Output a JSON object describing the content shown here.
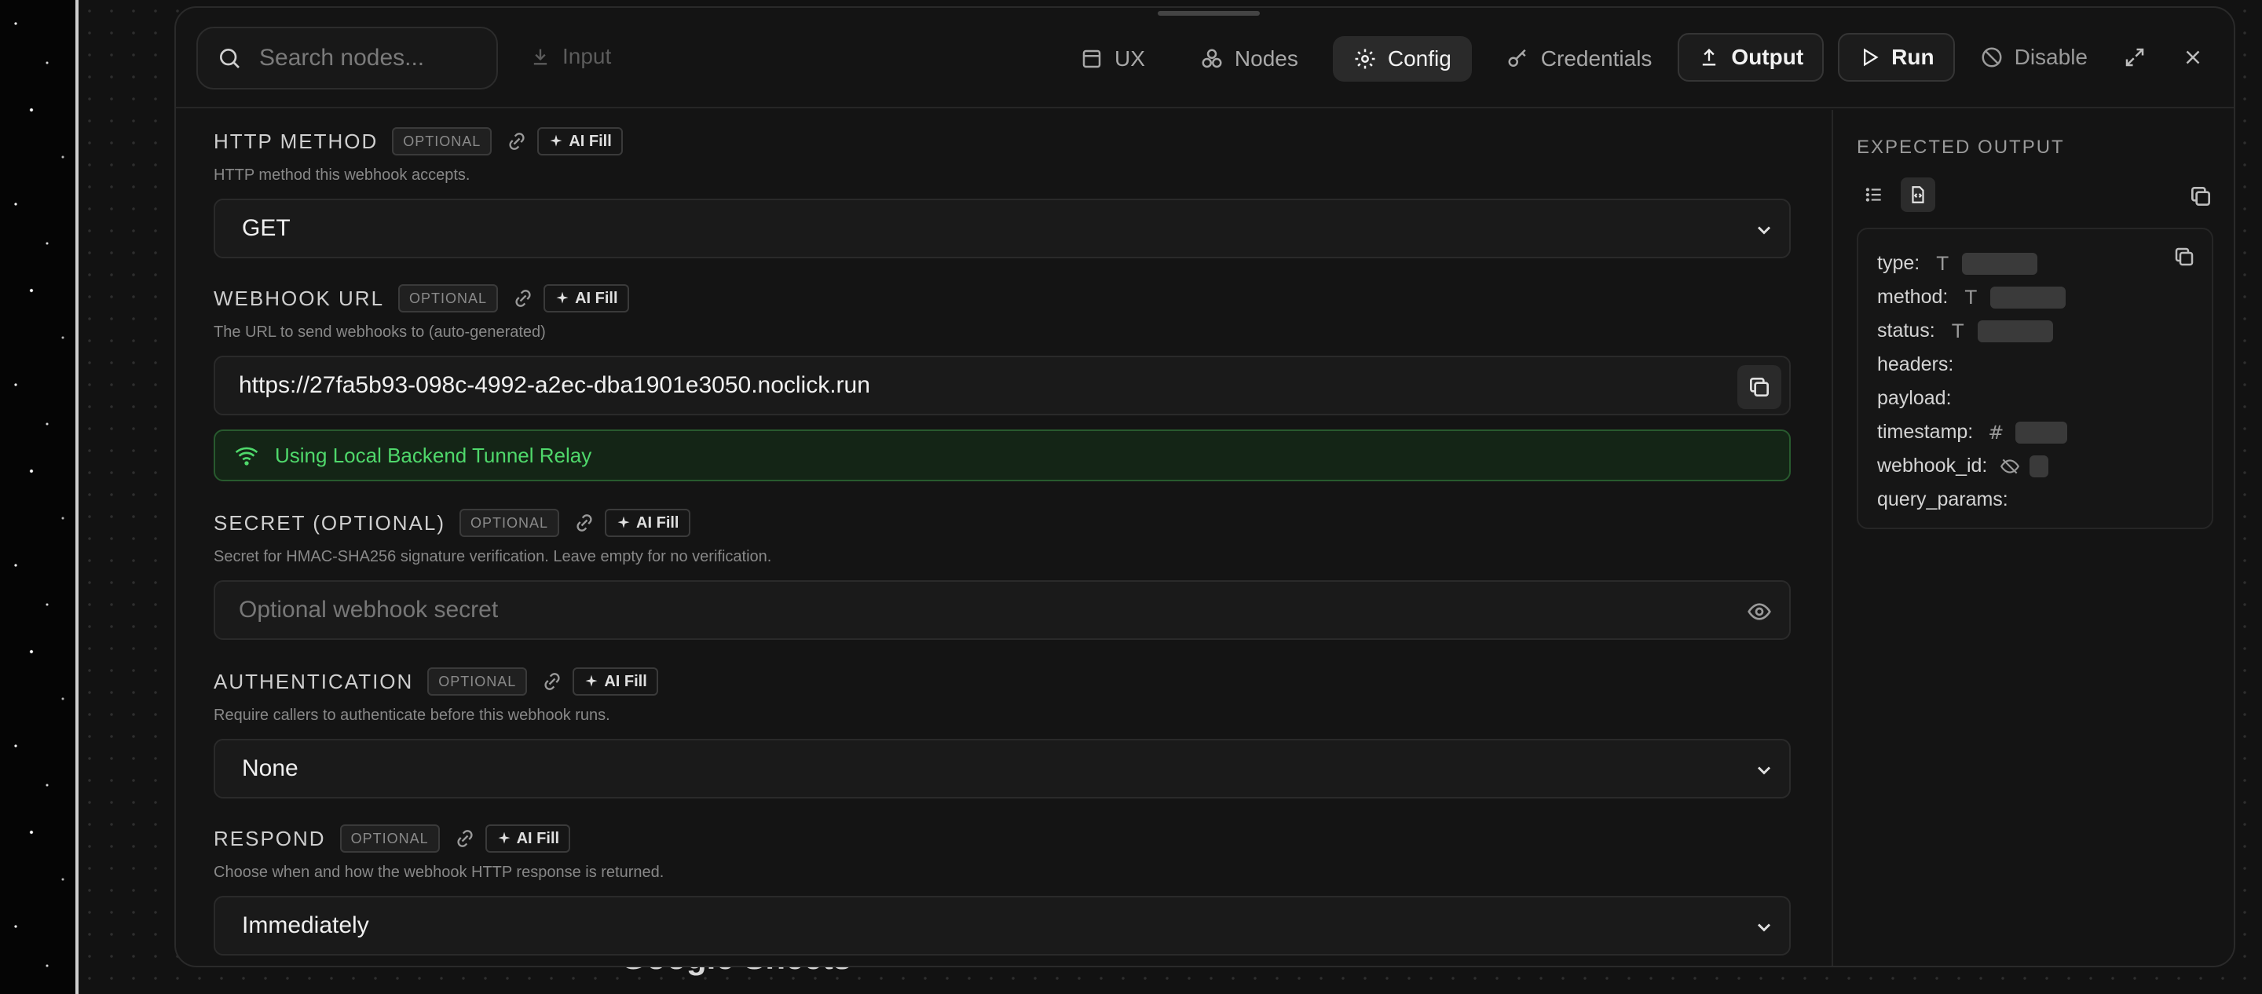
{
  "background": {
    "node_title": "Google Sheets"
  },
  "toolbar": {
    "search_placeholder": "Search nodes...",
    "input_label": "Input",
    "tabs": [
      {
        "label": "UX",
        "icon": "panel-icon",
        "active": false
      },
      {
        "label": "Nodes",
        "icon": "nodes-icon",
        "active": false
      },
      {
        "label": "Config",
        "icon": "gear-icon",
        "active": true
      },
      {
        "label": "Credentials",
        "icon": "key-icon",
        "active": false
      }
    ],
    "output_label": "Output",
    "run_label": "Run",
    "disable_label": "Disable"
  },
  "badges": {
    "optional": "OPTIONAL",
    "ai_fill": "AI Fill"
  },
  "sections": {
    "http_method": {
      "label": "HTTP METHOD",
      "desc": "HTTP method this webhook accepts.",
      "value": "GET"
    },
    "webhook_url": {
      "label": "WEBHOOK URL",
      "desc": "The URL to send webhooks to (auto-generated)",
      "value": "https://27fa5b93-098c-4992-a2ec-dba1901e3050.noclick.run",
      "tunnel_status": "Using Local Backend Tunnel Relay"
    },
    "secret": {
      "label": "SECRET (OPTIONAL)",
      "desc": "Secret for HMAC-SHA256 signature verification. Leave empty for no verification.",
      "placeholder": "Optional webhook secret"
    },
    "authentication": {
      "label": "AUTHENTICATION",
      "desc": "Require callers to authenticate before this webhook runs.",
      "value": "None"
    },
    "respond": {
      "label": "RESPOND",
      "desc": "Choose when and how the webhook HTTP response is returned.",
      "value": "Immediately"
    }
  },
  "expected_output": {
    "title": "EXPECTED OUTPUT",
    "fields": [
      {
        "name": "type:",
        "type_icon": "text-type-icon"
      },
      {
        "name": "method:",
        "type_icon": "text-type-icon"
      },
      {
        "name": "status:",
        "type_icon": "text-type-icon"
      },
      {
        "name": "headers:",
        "type_icon": ""
      },
      {
        "name": "payload:",
        "type_icon": ""
      },
      {
        "name": "timestamp:",
        "type_icon": "number-type-icon"
      },
      {
        "name": "webhook_id:",
        "type_icon": "null-type-icon"
      },
      {
        "name": "query_params:",
        "type_icon": ""
      }
    ]
  },
  "colors": {
    "accent_green": "#4fd86b",
    "tunnel_bg": "#142516",
    "modal_bg": "#141414"
  }
}
